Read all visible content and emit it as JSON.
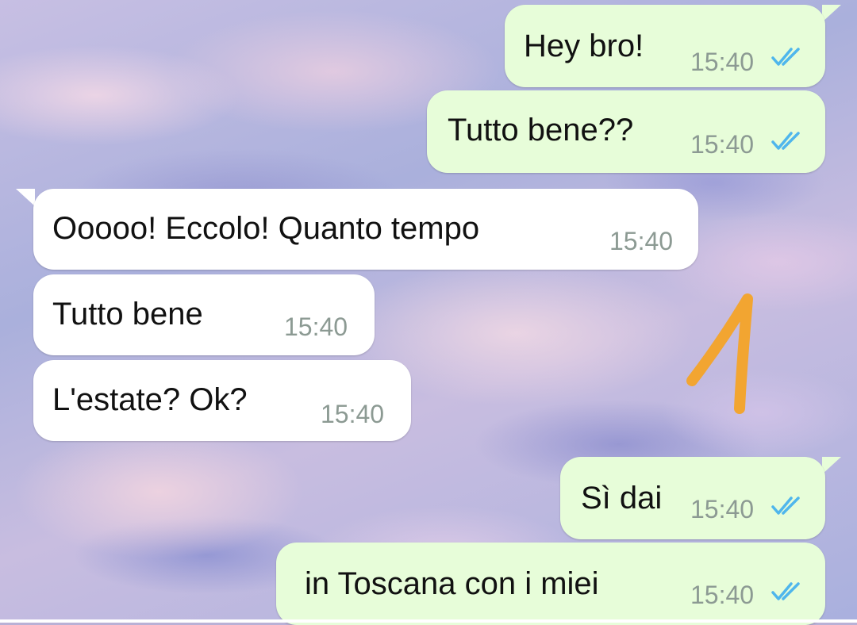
{
  "colors": {
    "outgoing_bubble": "#e7fdd9",
    "incoming_bubble": "#ffffff",
    "read_ticks": "#4fb6ec",
    "timestamp": "#8c9a93",
    "annotation_stroke": "#f2a531"
  },
  "messages": [
    {
      "direction": "outgoing",
      "text": "Hey bro!",
      "time": "15:40",
      "status_icon": "double-check-read-icon"
    },
    {
      "direction": "outgoing",
      "text": "Tutto bene??",
      "time": "15:40",
      "status_icon": "double-check-read-icon"
    },
    {
      "direction": "incoming",
      "text": "Ooooo! Eccolo! Quanto tempo",
      "time": "15:40"
    },
    {
      "direction": "incoming",
      "text": "Tutto bene",
      "time": "15:40"
    },
    {
      "direction": "incoming",
      "text": "L'estate? Ok?",
      "time": "15:40"
    },
    {
      "direction": "outgoing",
      "text": "Sì dai",
      "time": "15:40",
      "status_icon": "double-check-read-icon"
    },
    {
      "direction": "outgoing",
      "text": "in Toscana con i miei",
      "time": "15:40",
      "status_icon": "double-check-read-icon"
    }
  ],
  "annotation": {
    "icon": "handwritten-number-one-icon",
    "text": "1"
  }
}
